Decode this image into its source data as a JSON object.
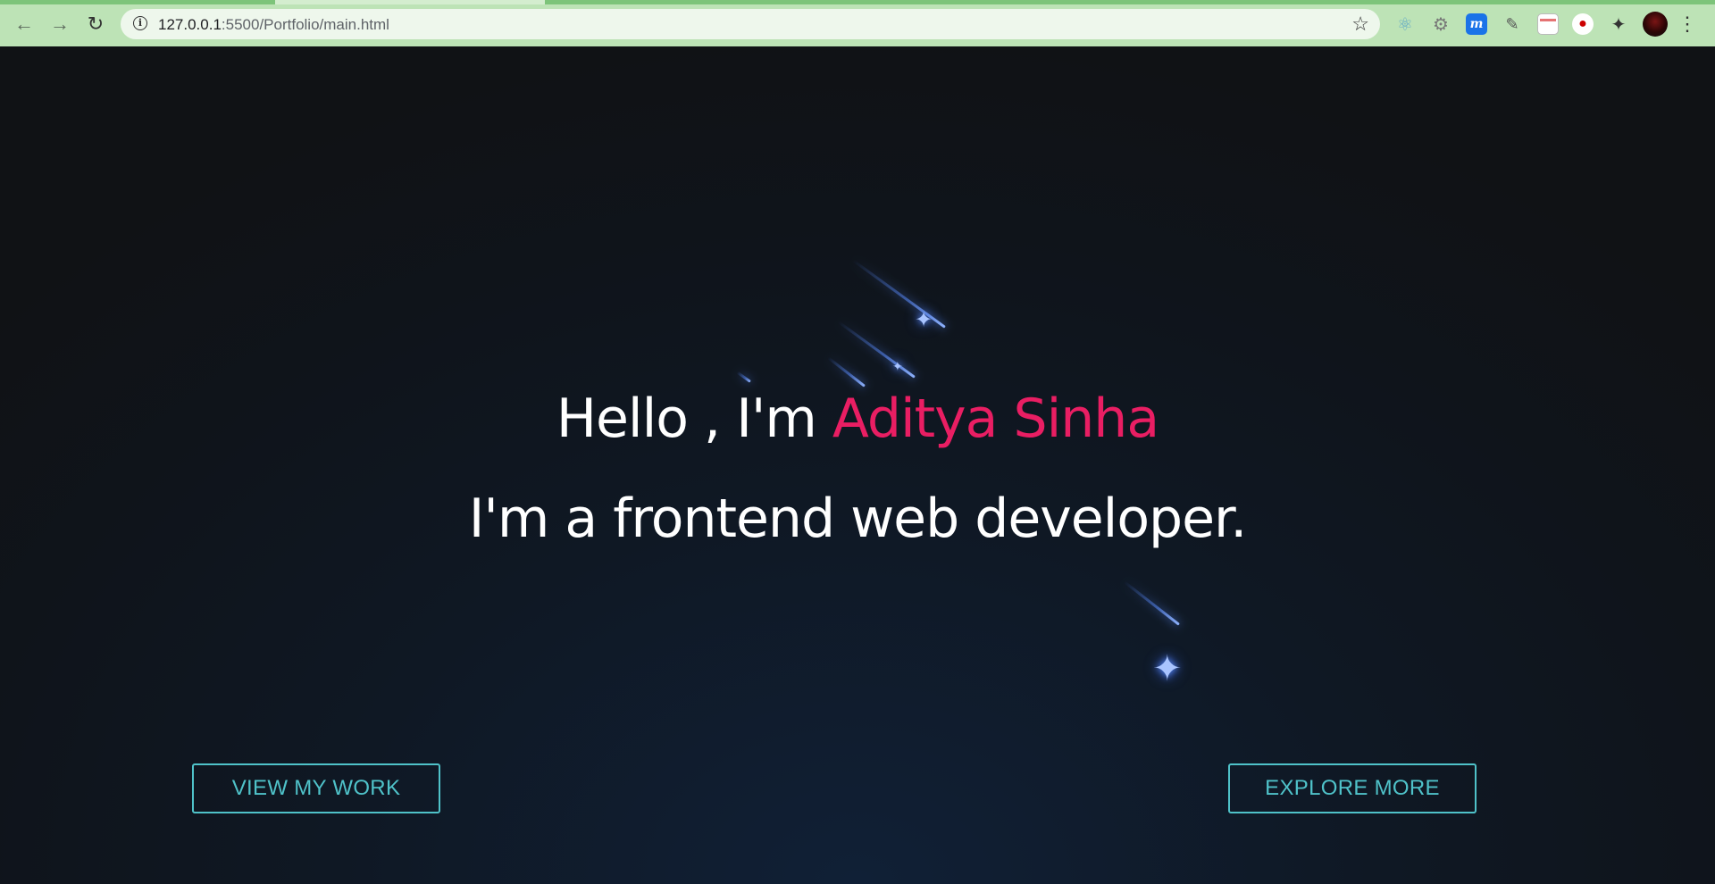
{
  "browser": {
    "back_icon": "arrow-left-icon",
    "forward_icon": "arrow-right-icon",
    "reload_icon": "reload-icon",
    "url_host": "127.0.0.1",
    "url_rest": ":5500/Portfolio/main.html",
    "bookmark_icon": "star-icon",
    "extensions": [
      "react-devtools-icon",
      "gear-extension-icon",
      "m-extension-icon",
      "color-picker-icon",
      "calendar-extension-icon",
      "lens-extension-icon",
      "puzzle-icon",
      "profile-avatar",
      "kebab-menu-icon"
    ],
    "theme_color": "#bde3b6"
  },
  "hero": {
    "greeting": "Hello , I'm ",
    "name": "Aditya Sinha",
    "tagline": "I'm a frontend web developer.",
    "name_color": "#e91e63",
    "text_color": "#ffffff"
  },
  "actions": {
    "view_work": "VIEW MY WORK",
    "explore_more": "EXPLORE MORE",
    "accent_color": "#4fc2c9"
  }
}
